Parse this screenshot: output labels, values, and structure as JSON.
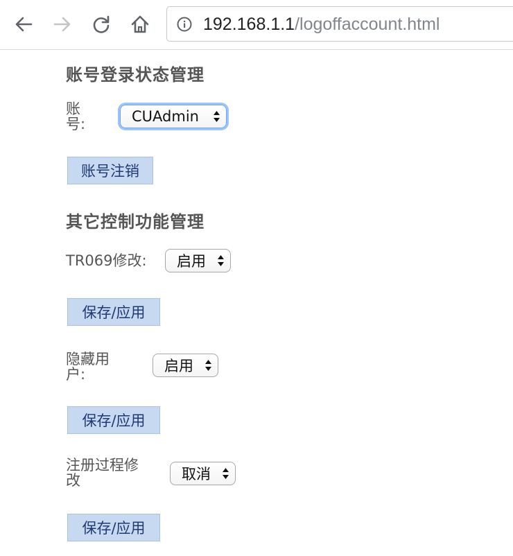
{
  "browser": {
    "url_host": "192.168.1.1",
    "url_path": "/logoffaccount.html",
    "back_icon": "back-arrow-icon",
    "forward_icon": "forward-arrow-icon",
    "reload_icon": "reload-icon",
    "home_icon": "home-icon",
    "info_icon": "info-icon"
  },
  "account_section": {
    "title": "账号登录状态管理",
    "account_label_line1": "账",
    "account_label_line2": "号:",
    "account_selected": "CUAdmin",
    "logoff_button": "账号注销"
  },
  "other_section": {
    "title": "其它控制功能管理",
    "tr069_label": "TR069修改:",
    "tr069_selected": "启用",
    "tr069_save": "保存/应用",
    "hidden_user_label_line1": "隐藏用",
    "hidden_user_label_line2": "户:",
    "hidden_user_selected": "启用",
    "hidden_user_save": "保存/应用",
    "register_label_line1": "注册过程修",
    "register_label_line2": "改",
    "register_selected": "取消",
    "register_save": "保存/应用"
  },
  "colors": {
    "button_bg": "#c6d9f1",
    "button_text": "#1f3a73",
    "focus_ring": "#9cc3fa",
    "label_text": "#555555"
  }
}
